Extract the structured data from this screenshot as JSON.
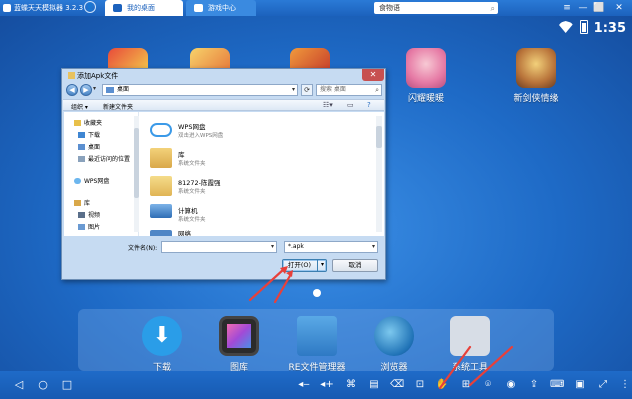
{
  "app": {
    "title": "蓝蝶天天模拟器 3.2.3",
    "tabs": [
      {
        "label": "我的桌面"
      },
      {
        "label": "游戏中心"
      }
    ],
    "search": {
      "value": "食物语"
    }
  },
  "status": {
    "time": "1:35"
  },
  "desktop_apps": [
    {
      "label": "闪耀暖暖"
    },
    {
      "label": "新剑侠情缘"
    }
  ],
  "dock": [
    {
      "label": "下载"
    },
    {
      "label": "图库"
    },
    {
      "label": "RE文件管理器"
    },
    {
      "label": "浏览器"
    },
    {
      "label": "系统工具"
    }
  ],
  "dialog": {
    "title": "添加Apk文件",
    "address": "桌面",
    "search_placeholder": "搜索 桌面",
    "toolbar": {
      "organize": "组织 ▾",
      "new_folder": "新建文件夹"
    },
    "nav": {
      "favorites": "收藏夹",
      "items": [
        "下载",
        "桌面",
        "最近访问的位置"
      ],
      "wps": "WPS网盘",
      "library": "库",
      "lib_items": [
        "视频",
        "图片"
      ]
    },
    "files": [
      {
        "name": "WPS网盘",
        "sub": "双击进入WPS网盘",
        "icon": "cloud-icon"
      },
      {
        "name": "库",
        "sub": "系统文件夹",
        "icon": "library-folder-icon"
      },
      {
        "name": "81272-陈霞强",
        "sub": "系统文件夹",
        "icon": "user-folder-icon"
      },
      {
        "name": "计算机",
        "sub": "系统文件夹",
        "icon": "computer-icon"
      },
      {
        "name": "网络",
        "sub": "",
        "icon": "network-icon"
      }
    ],
    "filename_label": "文件名(N):",
    "filename_value": "",
    "filetype": "*.apk",
    "open_label": "打开(O)",
    "cancel_label": "取消"
  },
  "colors": {
    "accent": "#1c62bd",
    "annotation_arrow": "#e8403a"
  }
}
